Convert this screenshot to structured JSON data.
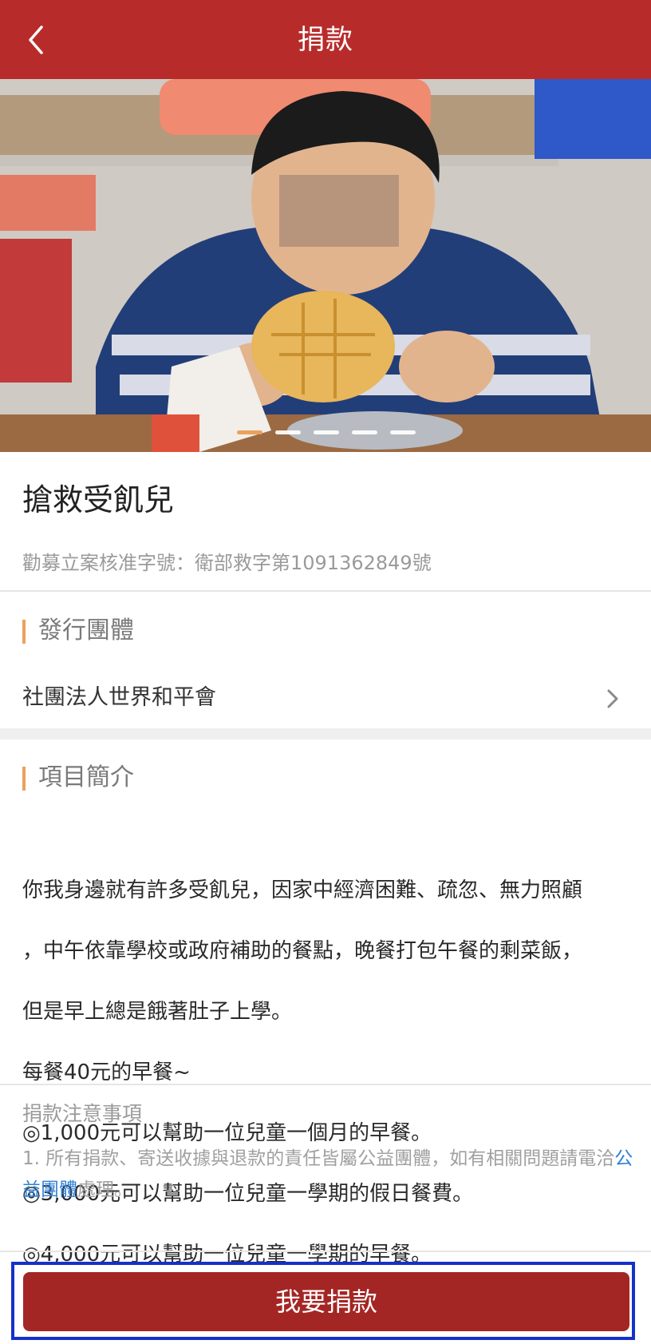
{
  "header": {
    "title": "捐款"
  },
  "hero": {
    "image_desc": "boy eating pineapple bun at school table",
    "slide_count": 5,
    "active_slide": 1
  },
  "project": {
    "title": "搶救受飢兒",
    "permit": "勸募立案核准字號：衛部救字第1091362849號"
  },
  "issuer": {
    "section_title": "發行團體",
    "org_name": "社團法人世界和平會"
  },
  "intro": {
    "section_title": "項目簡介",
    "lines": [
      "你我身邊就有許多受飢兒，因家中經濟困難、疏忽、無力照顧",
      "，中午依靠學校或政府補助的餐點，晚餐打包午餐的剩菜飯，",
      "但是早上總是餓著肚子上學。",
      "每餐40元的早餐~",
      "◎1,000元可以幫助一位兒童一個月的早餐。",
      "◎3,000元可以幫助一位兒童一學期的假日餐費。",
      "◎4,000元可以幫助一位兒童一學期的早餐。"
    ]
  },
  "notes": {
    "title": "捐款注意事項",
    "text_before": "1. 所有捐款、寄送收據與退款的責任皆屬公益團體，如有相關問題請電洽",
    "link": "公益團體",
    "text_after": "處理。"
  },
  "footer": {
    "donate_label": "我要捐款"
  },
  "colors": {
    "brand_red": "#B72C2A",
    "button_red": "#A42624",
    "accent": "#E9A25B",
    "link": "#2f7fd6"
  }
}
